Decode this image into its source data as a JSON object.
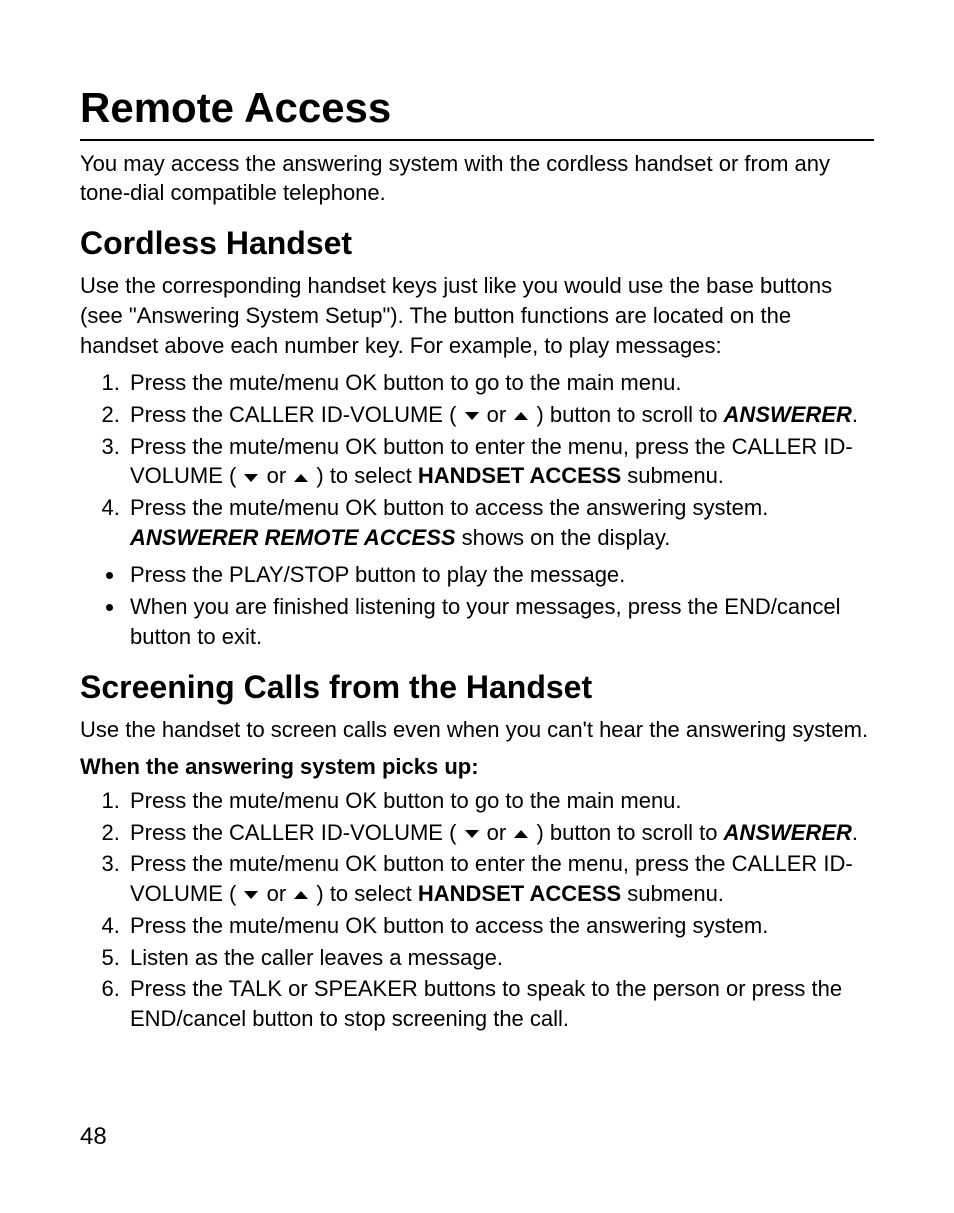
{
  "h1": "Remote Access",
  "intro": "You may access the answering system with the cordless handset or from any tone-dial compatible telephone.",
  "h2a": "Cordless Handset",
  "para2": "Use the corresponding handset keys just like you would use the base buttons (see \"Answering System Setup\"). The button functions are located on the handset above each number key. For example, to play messages:",
  "listA": {
    "i1": "Press the mute/menu OK button to go to the main menu.",
    "i2_a": "Press the CALLER ID-VOLUME ( ",
    "i2_or": " or ",
    "i2_b": " ) button to scroll to ",
    "i2_bold": "ANSWERER",
    "i2_c": ".",
    "i3_a": "Press the mute/menu OK button to enter the menu, press the CALLER ID-VOLUME ( ",
    "i3_or": " or ",
    "i3_b": " ) to select ",
    "i3_bold": "HANDSET ACCESS",
    "i3_c": " submenu.",
    "i4_a": "Press the mute/menu OK button to access the answering system. ",
    "i4_bold": "ANSWERER REMOTE ACCESS",
    "i4_b": " shows on the display."
  },
  "bulA": {
    "b1": "Press the PLAY/STOP button to play the message.",
    "b2": "When you are finished listening to your messages, press the END/cancel button to exit."
  },
  "h2b": "Screening Calls from the Handset",
  "para3": "Use the handset to screen calls even when you can't hear the answering system.",
  "sub": "When the answering system picks up:",
  "listB": {
    "i1": "Press the mute/menu OK button to go to the main menu.",
    "i2_a": "Press the CALLER ID-VOLUME ( ",
    "i2_or": " or ",
    "i2_b": " ) button to scroll to ",
    "i2_bold": "ANSWERER",
    "i2_c": ".",
    "i3_a": "Press the mute/menu OK button to enter the menu, press the CALLER ID-VOLUME ( ",
    "i3_or": " or ",
    "i3_b": " ) to select ",
    "i3_bold": "HANDSET ACCESS",
    "i3_c": " submenu.",
    "i4": "Press the mute/menu OK button to access the answering system.",
    "i5": "Listen as the caller leaves a message.",
    "i6": "Press the TALK or SPEAKER buttons to speak to the person or press the END/cancel button to stop screening the call."
  },
  "pageNumber": "48"
}
